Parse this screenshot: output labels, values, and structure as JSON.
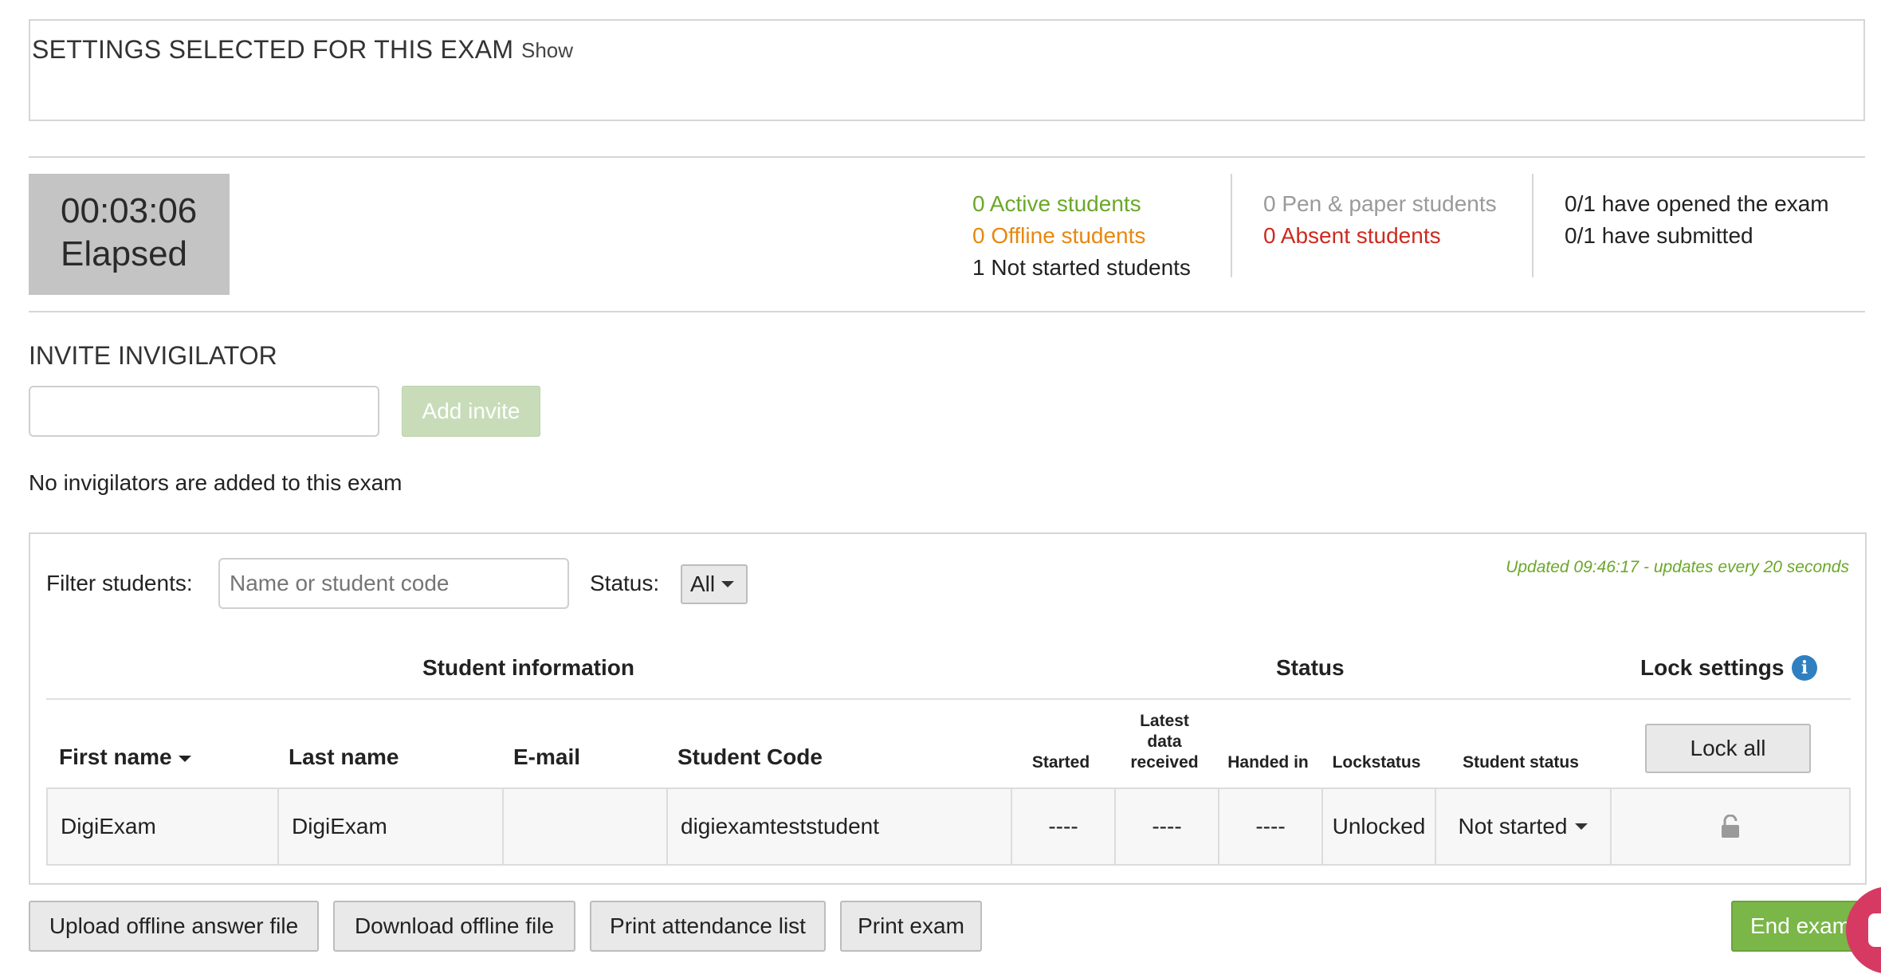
{
  "settings": {
    "title": "SETTINGS SELECTED FOR THIS EXAM",
    "show_label": "Show"
  },
  "timer": {
    "time": "00:03:06",
    "label": "Elapsed"
  },
  "stats": {
    "active": "0 Active students",
    "offline": "0 Offline students",
    "not_started": "1 Not started students",
    "pen_paper": "0 Pen & paper students",
    "absent": "0 Absent students",
    "opened": "0/1 have opened the exam",
    "submitted": "0/1 have submitted"
  },
  "invite": {
    "title": "INVITE INVIGILATOR",
    "input_value": "",
    "add_label": "Add invite",
    "none_text": "No invigilators are added to this exam"
  },
  "filter": {
    "label": "Filter students:",
    "placeholder": "Name or student code",
    "status_label": "Status:",
    "status_value": "All",
    "updated_text": "Updated 09:46:17 - updates every 20 seconds"
  },
  "table": {
    "groups": {
      "student_info": "Student information",
      "status": "Status",
      "lock_settings": "Lock settings"
    },
    "columns": {
      "first_name": "First name",
      "last_name": "Last name",
      "email": "E-mail",
      "student_code": "Student Code",
      "started": "Started",
      "latest_1": "Latest",
      "latest_2": "data",
      "latest_3": "received",
      "handed_in": "Handed in",
      "lockstatus": "Lockstatus",
      "student_status": "Student status"
    },
    "lock_all_label": "Lock all",
    "rows": [
      {
        "first_name": "DigiExam",
        "last_name": "DigiExam",
        "email": "",
        "student_code": "digiexamteststudent",
        "started": "----",
        "latest": "----",
        "handed_in": "----",
        "lockstatus": "Unlocked",
        "student_status": "Not started"
      }
    ]
  },
  "actions": {
    "upload": "Upload offline answer file",
    "download": "Download offline file",
    "print_attendance": "Print attendance list",
    "print_exam": "Print exam",
    "end_exam": "End exam"
  },
  "colors": {
    "green": "#6aa828",
    "orange": "#e8870e",
    "red": "#cc2b1f",
    "info": "#2f7fc1",
    "end_button": "#7ab648"
  },
  "icons": {
    "info": "info-icon",
    "lock": "unlocked-padlock-icon",
    "chat": "chat-icon"
  }
}
